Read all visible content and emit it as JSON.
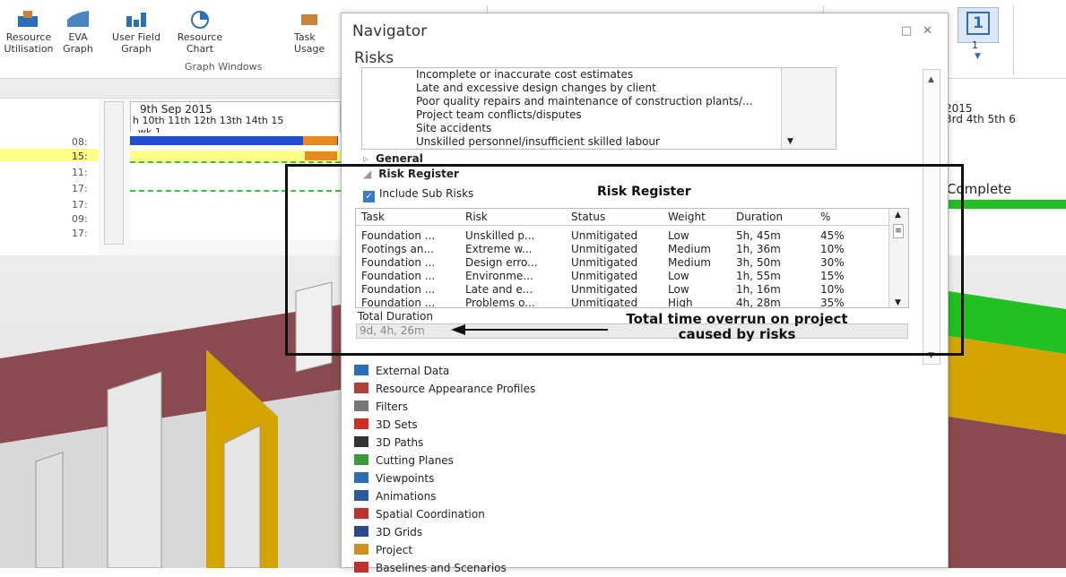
{
  "ribbon": {
    "buttons": [
      {
        "label": "Resource Utilisation",
        "icon": "resource-utilisation-icon"
      },
      {
        "label": "EVA Graph",
        "icon": "eva-graph-icon"
      },
      {
        "label": "User Field Graph",
        "icon": "user-field-graph-icon"
      },
      {
        "label": "Resource Chart",
        "icon": "resource-chart-icon"
      },
      {
        "label": "Task Usage",
        "icon": "task-usage-icon"
      }
    ],
    "group_label": "Graph Windows",
    "right_number": "1"
  },
  "gantt": {
    "date_header": "9th Sep 2015",
    "days": "h 10th 11th 12th 13th 14th 15",
    "week": "wk 1",
    "row_times": [
      "08:",
      "15:",
      "11:",
      "17:",
      "17:",
      "09:",
      "17:"
    ],
    "right_header": "2015",
    "right_days": "3rd 4th 5th 6",
    "right_label": "Complete"
  },
  "navigator": {
    "title": "Navigator",
    "subtitle": "Risks",
    "risk_items": [
      "Incomplete or inaccurate cost estimates",
      "Late and excessive design changes by client",
      "Poor quality repairs and maintenance of construction plants/...",
      "Project team conflicts/disputes",
      "Site accidents",
      "Unskilled personnel/insufficient skilled labour"
    ],
    "section_general": "General",
    "section_risk_register": "Risk Register",
    "include_sub_risks": "Include Sub Risks",
    "table": {
      "headers": [
        "Task",
        "Risk",
        "Status",
        "Weight",
        "Duration",
        "%"
      ],
      "rows": [
        [
          "Foundation ...",
          "Unskilled p...",
          "Unmitigated",
          "Low",
          "5h, 45m",
          "45%"
        ],
        [
          "Footings an...",
          "Extreme w...",
          "Unmitigated",
          "Medium",
          "1h, 36m",
          "10%"
        ],
        [
          "Foundation ...",
          "Design erro...",
          "Unmitigated",
          "Medium",
          "3h, 50m",
          "30%"
        ],
        [
          "Foundation ...",
          "Environme...",
          "Unmitigated",
          "Low",
          "1h, 55m",
          "15%"
        ],
        [
          "Foundation ...",
          "Late and e...",
          "Unmitigated",
          "Low",
          "1h, 16m",
          "10%"
        ],
        [
          "Foundation ...",
          "Problems o...",
          "Unmitigated",
          "High",
          "4h, 28m",
          "35%"
        ]
      ]
    },
    "total_duration_label": "Total Duration",
    "total_duration_value": "9d, 4h, 26m",
    "menu_items": [
      {
        "label": "External Data",
        "icon": "external-data-icon",
        "color": "#2a6fb8"
      },
      {
        "label": "Resource Appearance Profiles",
        "icon": "appearance-profiles-icon",
        "color": "#b0403a"
      },
      {
        "label": "Filters",
        "icon": "filter-icon",
        "color": "#777777"
      },
      {
        "label": "3D Sets",
        "icon": "3d-sets-icon",
        "color": "#d03020"
      },
      {
        "label": "3D Paths",
        "icon": "3d-paths-icon",
        "color": "#333333"
      },
      {
        "label": "Cutting Planes",
        "icon": "cutting-planes-icon",
        "color": "#3a9a3a"
      },
      {
        "label": "Viewpoints",
        "icon": "viewpoints-icon",
        "color": "#2a6fb8"
      },
      {
        "label": "Animations",
        "icon": "animations-icon",
        "color": "#2a5a9a"
      },
      {
        "label": "Spatial Coordination",
        "icon": "spatial-coordination-icon",
        "color": "#c03030"
      },
      {
        "label": "3D Grids",
        "icon": "3d-grids-icon",
        "color": "#2a4a8a"
      },
      {
        "label": "Project",
        "icon": "project-icon",
        "color": "#d09020"
      },
      {
        "label": "Baselines and Scenarios",
        "icon": "baselines-icon",
        "color": "#c03030"
      }
    ]
  },
  "annotations": {
    "risk_register_label": "Risk Register",
    "overrun_note": "Total time overrun on project caused by risks"
  },
  "colors": {
    "accent": "#3a78c8",
    "wall": "#8a4a50",
    "panel_yellow": "#d4a400",
    "green": "#22c022",
    "bar_blue": "#1f4fd0",
    "bar_orange": "#e88a20"
  }
}
